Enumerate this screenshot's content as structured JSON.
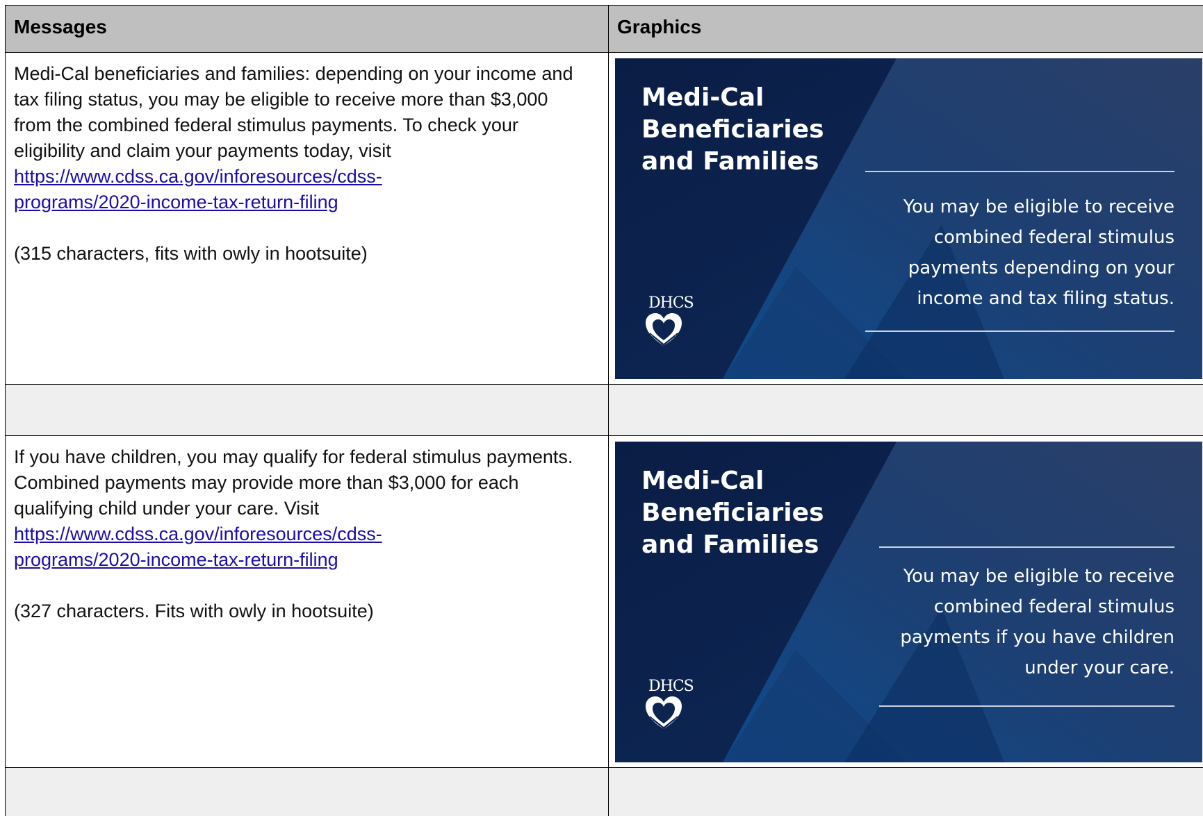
{
  "table": {
    "headers": {
      "messages": "Messages",
      "graphics": "Graphics"
    },
    "rows": [
      {
        "message": "Medi-Cal beneficiaries and families: depending on your income and tax filing status, you may be eligible to receive more than $3,000 from the combined federal stimulus payments. To check your eligibility and claim your payments today, visit",
        "link": "https://www.cdss.ca.gov/inforesources/cdss-programs/2020-income-tax-return-filing",
        "note": "(315 characters, fits with owly in hootsuite)",
        "graphic": {
          "title": "Medi-Cal Beneficiaries and Families",
          "body": "You may be eligible to receive combined federal stimulus payments depending on your income and tax filing status.",
          "logo_text": "DHCS"
        }
      },
      {
        "message": "If you have children, you may qualify for federal stimulus payments. Combined payments may provide more than $3,000 for each qualifying child under your care. Visit",
        "link": "https://www.cdss.ca.gov/inforesources/cdss-programs/2020-income-tax-return-filing",
        "note": "(327 characters. Fits with owly in hootsuite)",
        "graphic": {
          "title": "Medi-Cal Beneficiaries and Families",
          "body": "You may be eligible to receive combined federal stimulus payments if you have children under your care.",
          "logo_text": "DHCS"
        }
      }
    ]
  },
  "colors": {
    "header_bg": "#bfbfbf",
    "spacer_bg": "#efefef",
    "link": "#1a0dab",
    "graphic_bg": "#0d2350",
    "graphic_accent": "#1d5590"
  }
}
